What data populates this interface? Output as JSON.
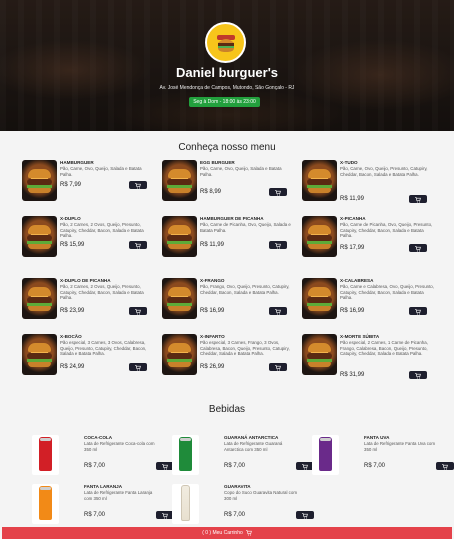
{
  "restaurant": {
    "name": "Daniel burguer's",
    "address": "Av. José Mendonça de Campos, Mutondo, São Gonçalo - RJ",
    "hours": "Seg à Dom - 18:00 às 23:00"
  },
  "menu_section": {
    "title": "Conheça nosso menu",
    "items": [
      {
        "name": "HAMBURGUER",
        "desc": "Pão, Carne, Ovo, Queijo, Salada e Batata Palha.",
        "price": "R$ 7,99"
      },
      {
        "name": "EGG BURGUER",
        "desc": "Pão, Carne, Ovo, Queijo, Salada e Batata Palha.",
        "price": "R$ 8,99"
      },
      {
        "name": "X-TUDO",
        "desc": "Pão, Carne, Ovo, Queijo, Presunto, Catupiry, Cheddar, Bacon, Salada e Batata Palha.",
        "price": "R$ 11,99"
      },
      {
        "name": "X-DUPLO",
        "desc": "Pão, 2 Carnes, 2 Ovos, Queijo, Presunto, Catupiry, Cheddar, Bacon, Salada e Batata Palha.",
        "price": "R$ 15,99"
      },
      {
        "name": "HAMBURGUER DE PICANHA",
        "desc": "Pão, Carne de Picanha, Ovo, Queijo, Salada e Batata Palha.",
        "price": "R$ 11,99"
      },
      {
        "name": "X-PICANHA",
        "desc": "Pão, Carne de Picanha, Ovo, Queijo, Presunto, Catupiry, Cheddar, Bacon, Salada e Batata Palha.",
        "price": "R$ 17,99"
      },
      {
        "name": "X-DUPLO DE PICANHA",
        "desc": "Pão, 2 Carnes, 2 Ovos, Queijo, Presunto, Catupiry, Cheddar, Bacon, Salada e Batata Palha.",
        "price": "R$ 23,99"
      },
      {
        "name": "X-FRANGO",
        "desc": "Pão, Frango, Ovo, Queijo, Presunto, Catupiry, Cheddar, Bacon, Salada e Batata Palha.",
        "price": "R$ 16,99"
      },
      {
        "name": "X-CALABRESA",
        "desc": "Pão, Carne e Calabresa, Ovo, Queijo, Presunto, Catupiry, Cheddar, Bacon, Salada e Batata Palha.",
        "price": "R$ 16,99"
      },
      {
        "name": "X-BOCÃO",
        "desc": "Pão especial, 3 Carnes, 3 Ovos, Calabresa, Queijo, Presunto, Catupiry, Cheddar, Bacon, Salada e Batata Palha.",
        "price": "R$ 24,99"
      },
      {
        "name": "X-INFARTO",
        "desc": "Pão especial, 3 Carnes, Frango, 3 Ovos, Calabresa, Bacon, Queijo, Presunto, Catupiry, Cheddar, Salada e Batata Palha.",
        "price": "R$ 26,99"
      },
      {
        "name": "X-MORTE SÚBITA",
        "desc": "Pão especial, 2 Carnes, 1 Carne de Picanha, Frango, Calabresa, Bacon, Queijo, Presunto, Catupiry, Cheddar, Salada e Batata Palha.",
        "price": "R$ 31,99"
      }
    ]
  },
  "drinks_section": {
    "title": "Bebidas",
    "items": [
      {
        "name": "Coca-cola",
        "desc": "Lata de Refrigerante Coca-cola com 350 ml",
        "price": "R$ 7,00",
        "color": "#d21f26"
      },
      {
        "name": "GUARANÁ ANTARCTICA",
        "desc": "Lata de Refrigerante Guaraná Antarctica com 350 ml",
        "price": "R$ 7,00",
        "color": "#1f8b3a"
      },
      {
        "name": "FANTA UVA",
        "desc": "Lata de Refrigerante Fanta Uva com 350 ml",
        "price": "R$ 7,00",
        "color": "#6a2a8a"
      },
      {
        "name": "FANTA LARANJA",
        "desc": "Lata de Refrigerante Fanta Laranja com 350 ml",
        "price": "R$ 7,00",
        "color": "#f28a17"
      },
      {
        "name": "GUARAVITA",
        "desc": "Copo do Suco Guaravita Natural com 300 ml",
        "price": "R$ 7,00",
        "color": "#e8e0cf"
      }
    ]
  },
  "cart_bar": {
    "label": "( 0 ) Meu Carrinho"
  },
  "icons": {
    "cart": "shopping-cart-icon"
  },
  "colors": {
    "accent": "#e4424a",
    "button": "#1e1f2e",
    "hours_badge": "#22a03d"
  }
}
